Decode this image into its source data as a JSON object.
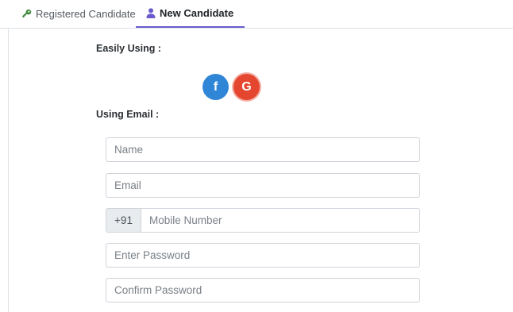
{
  "tabs": {
    "registered": {
      "label": "Registered Candidate",
      "icon": "key-icon"
    },
    "new": {
      "label": "New Candidate",
      "icon": "user-icon",
      "active": true
    }
  },
  "social": {
    "heading": "Easily Using :",
    "facebook": {
      "glyph": "f",
      "color": "#2f86d6"
    },
    "google": {
      "glyph": "G",
      "color": "#e5462f"
    }
  },
  "email_form": {
    "heading": "Using Email :",
    "name_placeholder": "Name",
    "email_placeholder": "Email",
    "phone_prefix": "+91",
    "mobile_placeholder": "Mobile Number",
    "password_placeholder": "Enter Password",
    "confirm_placeholder": "Confirm Password"
  },
  "colors": {
    "accent": "#6a5bcd",
    "key_icon": "#3f8a3a"
  }
}
